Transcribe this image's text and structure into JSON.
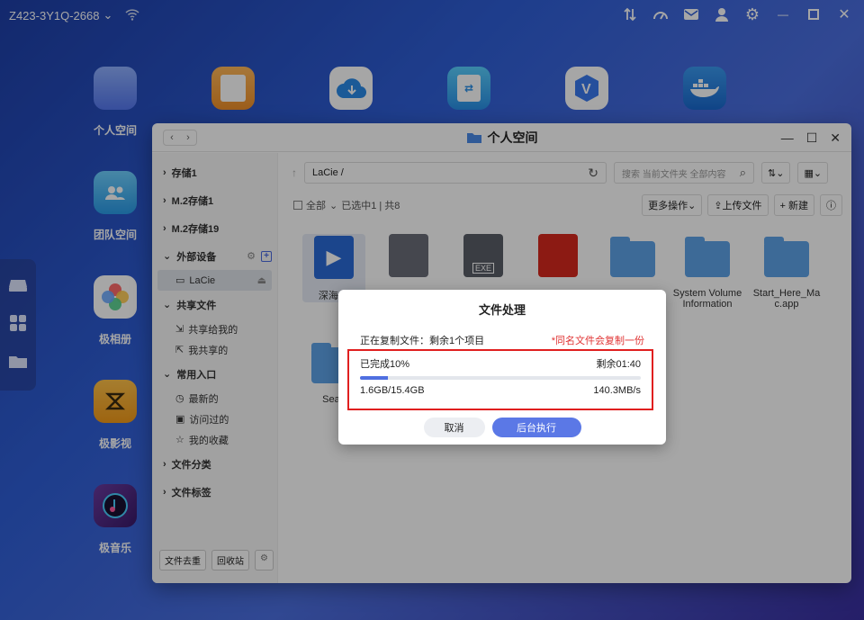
{
  "topbar": {
    "device_name": "Z423-3Y1Q-2668"
  },
  "desktop": {
    "apps": [
      {
        "label": "个人空间"
      },
      {
        "label": "团队空间"
      },
      {
        "label": "极相册"
      },
      {
        "label": "极影视"
      },
      {
        "label": "极音乐"
      }
    ]
  },
  "window": {
    "title": "个人空间",
    "sidebar": {
      "groups": [
        {
          "label": "存储1"
        },
        {
          "label": "M.2存储1"
        },
        {
          "label": "M.2存储19"
        },
        {
          "label": "外部设备"
        },
        {
          "label": "共享文件"
        },
        {
          "label": "常用入口"
        },
        {
          "label": "文件分类"
        },
        {
          "label": "文件标签"
        }
      ],
      "device_item": "LaCie",
      "shared": [
        "共享给我的",
        "我共享的"
      ],
      "common": [
        "最新的",
        "访问过的",
        "我的收藏"
      ],
      "footer": [
        "文件去重",
        "回收站"
      ]
    },
    "path": "LaCie /",
    "search_placeholder": "搜索 当前文件夹 全部内容",
    "toolbar": {
      "select_all": "全部",
      "status": "已选中1 | 共8",
      "more": "更多操作",
      "upload": "上传文件",
      "new": "+ 新建"
    },
    "files": [
      {
        "name": "深海.m",
        "type": "video"
      },
      {
        "name": "",
        "type": "doc"
      },
      {
        "name": "",
        "type": "exe",
        "badge": "EXE"
      },
      {
        "name": "",
        "type": "pdf"
      },
      {
        "name": "",
        "type": "folder"
      },
      {
        "name": "System Volume Information",
        "type": "folder"
      },
      {
        "name": "Start_Here_Mac.app",
        "type": "folder"
      },
      {
        "name": "Seag",
        "type": "folder"
      }
    ]
  },
  "dialog": {
    "title": "文件处理",
    "copying": "正在复制文件：剩余1个项目",
    "warning": "*同名文件会复制一份",
    "done": "已完成10%",
    "remaining": "剩余01:40",
    "progress": 0.1,
    "size": "1.6GB/15.4GB",
    "speed": "140.3MB/s",
    "cancel": "取消",
    "background": "后台执行"
  }
}
